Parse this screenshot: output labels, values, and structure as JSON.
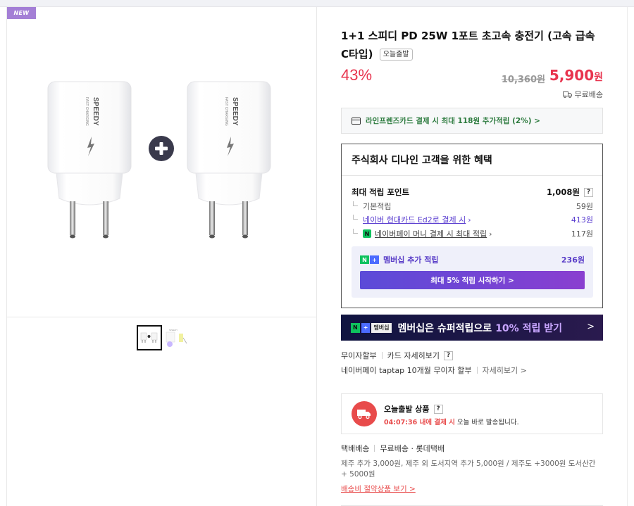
{
  "left": {
    "badge": "NEW",
    "product_brand": "SPEEDY",
    "product_sub": "FAST CHARGING",
    "plus_icon": "plus-circle-icon"
  },
  "product": {
    "title": "1+1 스피디 PD 25W 1포트 초고속 충전기 (고속 급속 C타입)",
    "tag": "오늘출발",
    "discount": "43%",
    "original_price": "10,360원",
    "sale_price_num": "5,900",
    "sale_price_unit": "원",
    "shipping": "무료배송"
  },
  "card_benefit": {
    "text": "라인프렌즈카드 결제 시 최대 118원 추가적립 (2%) >"
  },
  "benefit": {
    "heading": "주식회사 디나인 고객을 위한 혜택",
    "max_label": "최대 적립 포인트",
    "max_value": "1,008원",
    "rows": [
      {
        "label": "기본적립",
        "value": "59원"
      },
      {
        "label": "네이버 현대카드 Ed2로 결제 시",
        "value": "413원"
      },
      {
        "label": "네이버페이 머니 결제 시 최대 적립",
        "value": "117원"
      }
    ],
    "member_label": "멤버십 추가 적립",
    "member_value": "236원",
    "member_button": "최대 5% 적립 시작하기 >"
  },
  "membership_banner": {
    "badge": "멤버십",
    "text": "멤버십은 슈퍼적립으로",
    "highlight": "10% 적립 받기",
    "chevron": ">"
  },
  "payment": {
    "installment": "무이자할부",
    "card_detail": "카드 자세히보기",
    "npay_text": "네이버페이 taptap 10개월 무이자 할부",
    "npay_more": "자세히보기 >"
  },
  "today_ship": {
    "title": "오늘출발 상품",
    "time_red": "04:07:36 내에 결제 시",
    "time_rest": " 오늘 바로 발송됩니다."
  },
  "delivery": {
    "type": "택배배송",
    "fee": "무료배송 · 롯데택배",
    "extra": "제주 추가 3,000원, 제주 외 도서지역 추가 5,000원 / 제주도 +3000원 도서산간 + 5000원",
    "link": "배송비 절약상품 보기 >"
  },
  "colors": {
    "accent_red": "#e8344e",
    "naver_green": "#0ec25e",
    "member_purple": "#5a3ec8",
    "banner_dark": "#101440"
  }
}
